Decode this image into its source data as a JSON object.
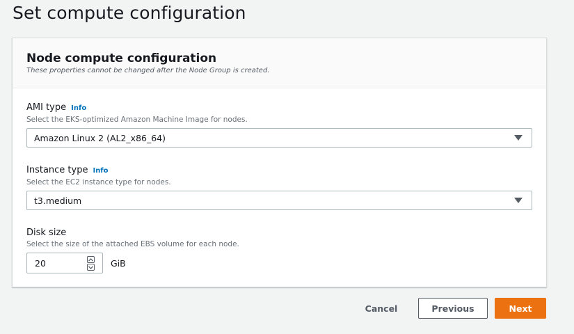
{
  "page": {
    "title": "Set compute configuration"
  },
  "panel": {
    "title": "Node compute configuration",
    "subtitle": "These properties cannot be changed after the Node Group is created."
  },
  "ami_type": {
    "label": "AMI type",
    "info": "Info",
    "description": "Select the EKS-optimized Amazon Machine Image for nodes.",
    "value": "Amazon Linux 2 (AL2_x86_64)"
  },
  "instance_type": {
    "label": "Instance type",
    "info": "Info",
    "description": "Select the EC2 instance type for nodes.",
    "value": "t3.medium"
  },
  "disk_size": {
    "label": "Disk size",
    "description": "Select the size of the attached EBS volume for each node.",
    "value": "20",
    "unit": "GiB"
  },
  "actions": {
    "cancel": "Cancel",
    "previous": "Previous",
    "next": "Next"
  },
  "colors": {
    "primary_button": "#ec7211",
    "link": "#0073bb",
    "background": "#f2f3f3"
  },
  "icons": {
    "select_caret": "caret-down-icon",
    "spin_up": "chevron-up-icon",
    "spin_down": "chevron-down-icon"
  }
}
